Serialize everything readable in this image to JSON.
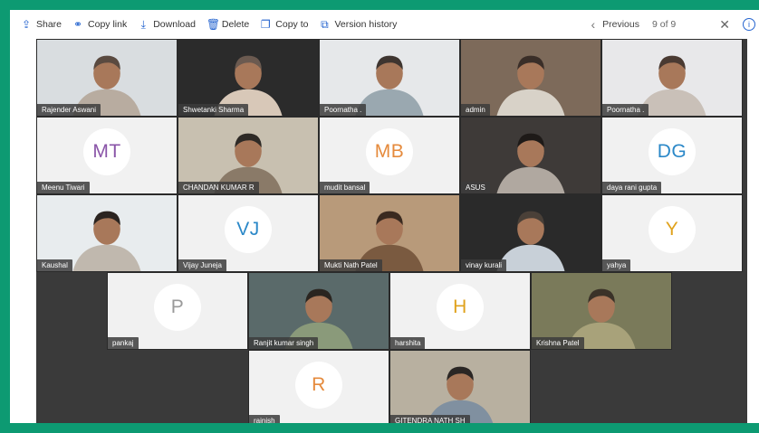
{
  "toolbar": {
    "share": "Share",
    "copy_link": "Copy link",
    "download": "Download",
    "delete": "Delete",
    "copy_to": "Copy to",
    "version_history": "Version history",
    "previous": "Previous",
    "counter": "9 of 9"
  },
  "colors": {
    "frame_border": "#0d9a72",
    "toolbar_icon": "#2564cf"
  },
  "participants": [
    {
      "name": "Rajender Aswani",
      "type": "video"
    },
    {
      "name": "Shwetanki Sharma",
      "type": "video"
    },
    {
      "name": "Poornatha .",
      "type": "video"
    },
    {
      "name": "admin",
      "type": "video"
    },
    {
      "name": "Poornatha .",
      "type": "video"
    },
    {
      "name": "Meenu Tiwari",
      "type": "initials",
      "initials": "MT",
      "color": "#8a55a8"
    },
    {
      "name": "CHANDAN KUMAR R",
      "type": "video"
    },
    {
      "name": "mudit bansal",
      "type": "initials",
      "initials": "MB",
      "color": "#e58a3c"
    },
    {
      "name": "ASUS",
      "type": "video"
    },
    {
      "name": "daya rani gupta",
      "type": "initials",
      "initials": "DG",
      "color": "#2b88c8"
    },
    {
      "name": "Kaushal",
      "type": "video"
    },
    {
      "name": "Vijay Juneja",
      "type": "initials",
      "initials": "VJ",
      "color": "#2b88c8"
    },
    {
      "name": "Mukti Nath Patel",
      "type": "video"
    },
    {
      "name": "vinay kurali",
      "type": "video"
    },
    {
      "name": "yahya",
      "type": "initials",
      "initials": "Y",
      "color": "#e0a21c"
    },
    {
      "name": "pankaj",
      "type": "initials",
      "initials": "P",
      "color": "#9a9a9a"
    },
    {
      "name": "Ranjit kumar singh",
      "type": "video"
    },
    {
      "name": "harshita",
      "type": "initials",
      "initials": "H",
      "color": "#e0a21c"
    },
    {
      "name": "Krishna Patel",
      "type": "video"
    },
    {
      "name": "rajnish",
      "type": "initials",
      "initials": "R",
      "color": "#e58a3c"
    },
    {
      "name": "GITENDRA NATH SH",
      "type": "video"
    }
  ]
}
